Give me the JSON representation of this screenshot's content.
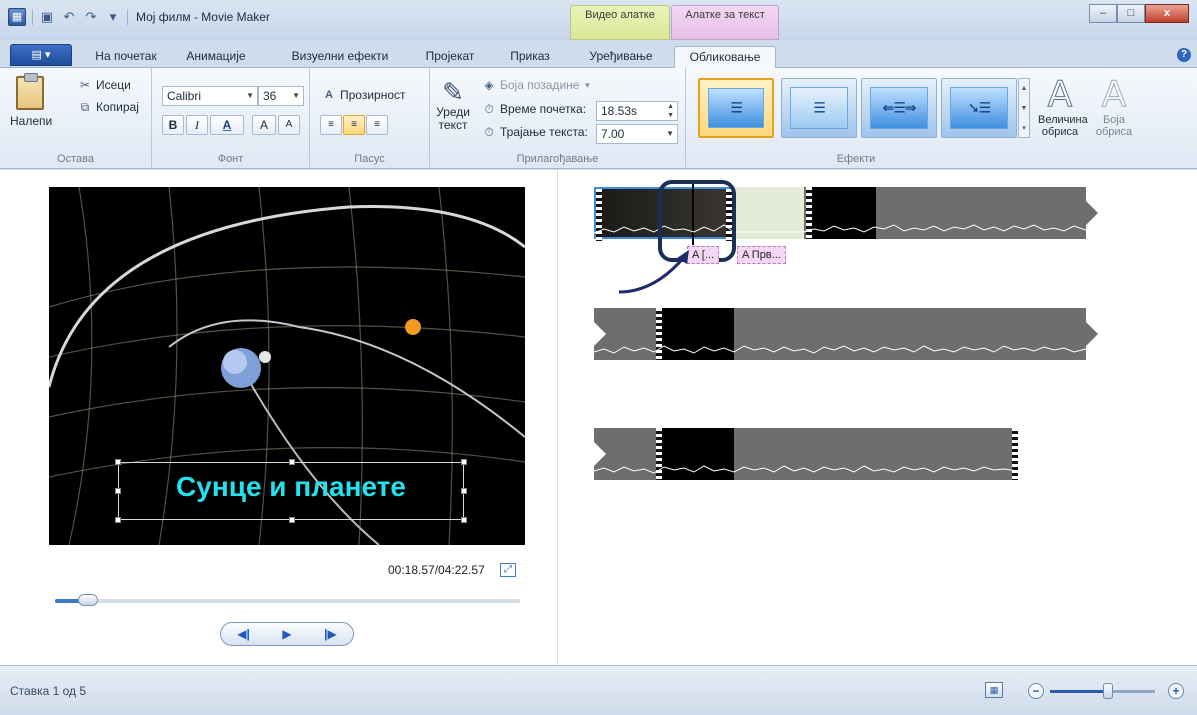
{
  "window": {
    "title": "Мој филм - Movie Maker",
    "context_groups": [
      {
        "label": "Видео алатке",
        "color": "#d9e898"
      },
      {
        "label": "Алатке за текст",
        "color": "#e7bfe9"
      }
    ],
    "controls": {
      "minimize": "–",
      "maximize": "□",
      "close": "x"
    }
  },
  "tabs": {
    "file_glyph": "▤ ▾",
    "items": [
      {
        "label": "На почетак"
      },
      {
        "label": "Анимације"
      },
      {
        "label": "Визуелни ефекти"
      },
      {
        "label": "Пројекат"
      },
      {
        "label": "Приказ"
      },
      {
        "label": "Уређивање"
      },
      {
        "label": "Обликовање",
        "active": true
      }
    ]
  },
  "ribbon": {
    "clipboard": {
      "group_label": "Остава",
      "paste": "Налепи",
      "cut": "Исеци",
      "copy": "Копирај"
    },
    "font": {
      "group_label": "Фонт",
      "family": "Calibri",
      "size": "36",
      "bold": "B",
      "italic": "I",
      "color": "A",
      "grow": "A",
      "shrink": "A"
    },
    "paragraph": {
      "group_label": "Пасус",
      "transparency": "Прозирност"
    },
    "adjust": {
      "group_label": "Прилагођавање",
      "edit_text": "Уреди текст",
      "background_color": "Боја позадине",
      "start_time_label": "Време почетка:",
      "start_time_value": "18.53s",
      "duration_label": "Трајање текста:",
      "duration_value": "7.00"
    },
    "effects": {
      "group_label": "Ефекти",
      "outline_size": "Величина обриса",
      "outline_color": "Боја обриса"
    }
  },
  "preview": {
    "caption": "Сунце и планете",
    "timecode": "00:18.57/04:22.57",
    "progress_fraction": 0.071
  },
  "timeline": {
    "chips": [
      {
        "label": "A [..."
      },
      {
        "label": "A Прв..."
      }
    ]
  },
  "statusbar": {
    "text": "Ставка 1 од 5",
    "zoom_fraction": 0.55
  }
}
